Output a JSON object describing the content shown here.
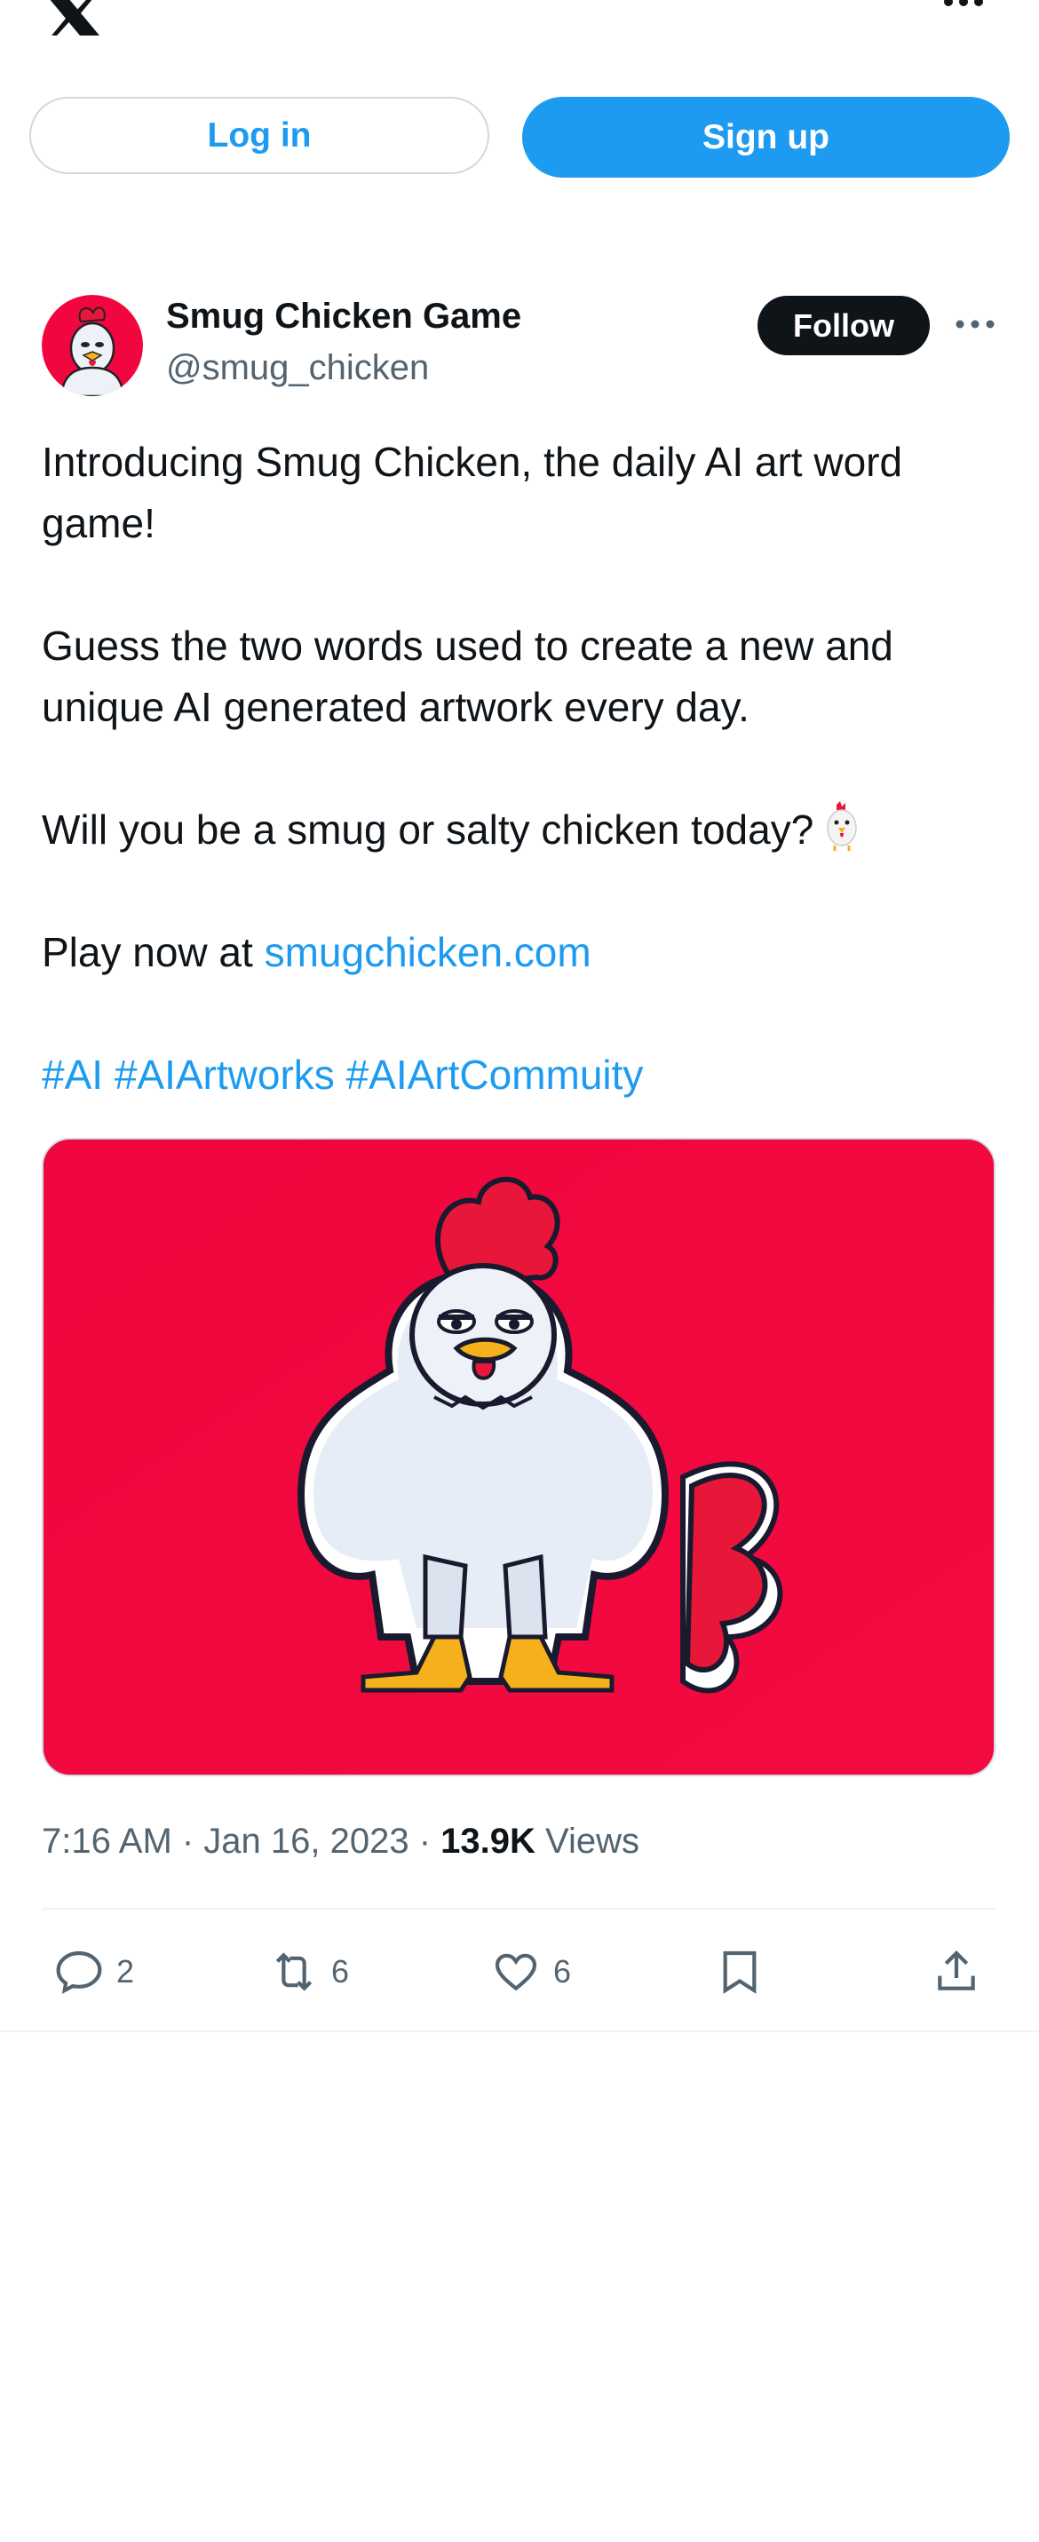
{
  "header": {
    "logo_icon": "x-logo-icon",
    "more_icon": "more-icon"
  },
  "auth": {
    "login_label": "Log in",
    "signup_label": "Sign up"
  },
  "tweet": {
    "author_name": "Smug Chicken Game",
    "author_handle": "@smug_chicken",
    "follow_label": "Follow",
    "text_line1": "Introducing Smug Chicken, the daily AI art word game!",
    "text_line2": "Guess the two words used to create a new and unique AI generated artwork every day.",
    "text_line3": "Will you be a smug or salty chicken today?",
    "play_prefix": "Play now at ",
    "play_link": "smugchicken.com",
    "hashtags": [
      "#AI",
      "#AIArtworks",
      "#AIArtCommuity"
    ],
    "timestamp": "7:16 AM · Jan 16, 2023 · ",
    "views_count": "13.9K",
    "views_label": " Views",
    "replies": "2",
    "retweets": "6",
    "likes": "6"
  },
  "colors": {
    "accent": "#1d9bf0",
    "media_bg": "#f2063f",
    "text": "#0f1419",
    "muted": "#536471"
  }
}
